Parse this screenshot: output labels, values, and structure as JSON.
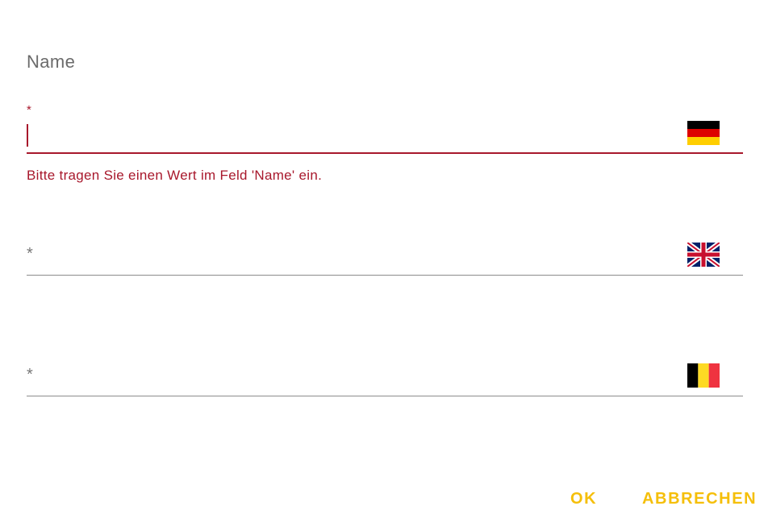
{
  "dialog": {
    "title": "Name",
    "fields": [
      {
        "language": "de",
        "flag_icon": "flag-germany-icon",
        "required_marker": "*",
        "value": "",
        "state": "error",
        "error_message": "Bitte tragen Sie einen Wert im Feld 'Name' ein."
      },
      {
        "language": "en",
        "flag_icon": "flag-uk-icon",
        "required_marker": "*",
        "value": "",
        "state": "normal"
      },
      {
        "language": "be",
        "flag_icon": "flag-belgium-icon",
        "required_marker": "*",
        "value": "",
        "state": "normal"
      }
    ],
    "buttons": {
      "ok_label": "OK",
      "cancel_label": "ABBRECHEN"
    }
  },
  "colors": {
    "error": "#a8182c",
    "accent": "#f5bf0a",
    "label_gray": "#6b6b6b",
    "underline_gray": "#8c8c8c"
  }
}
